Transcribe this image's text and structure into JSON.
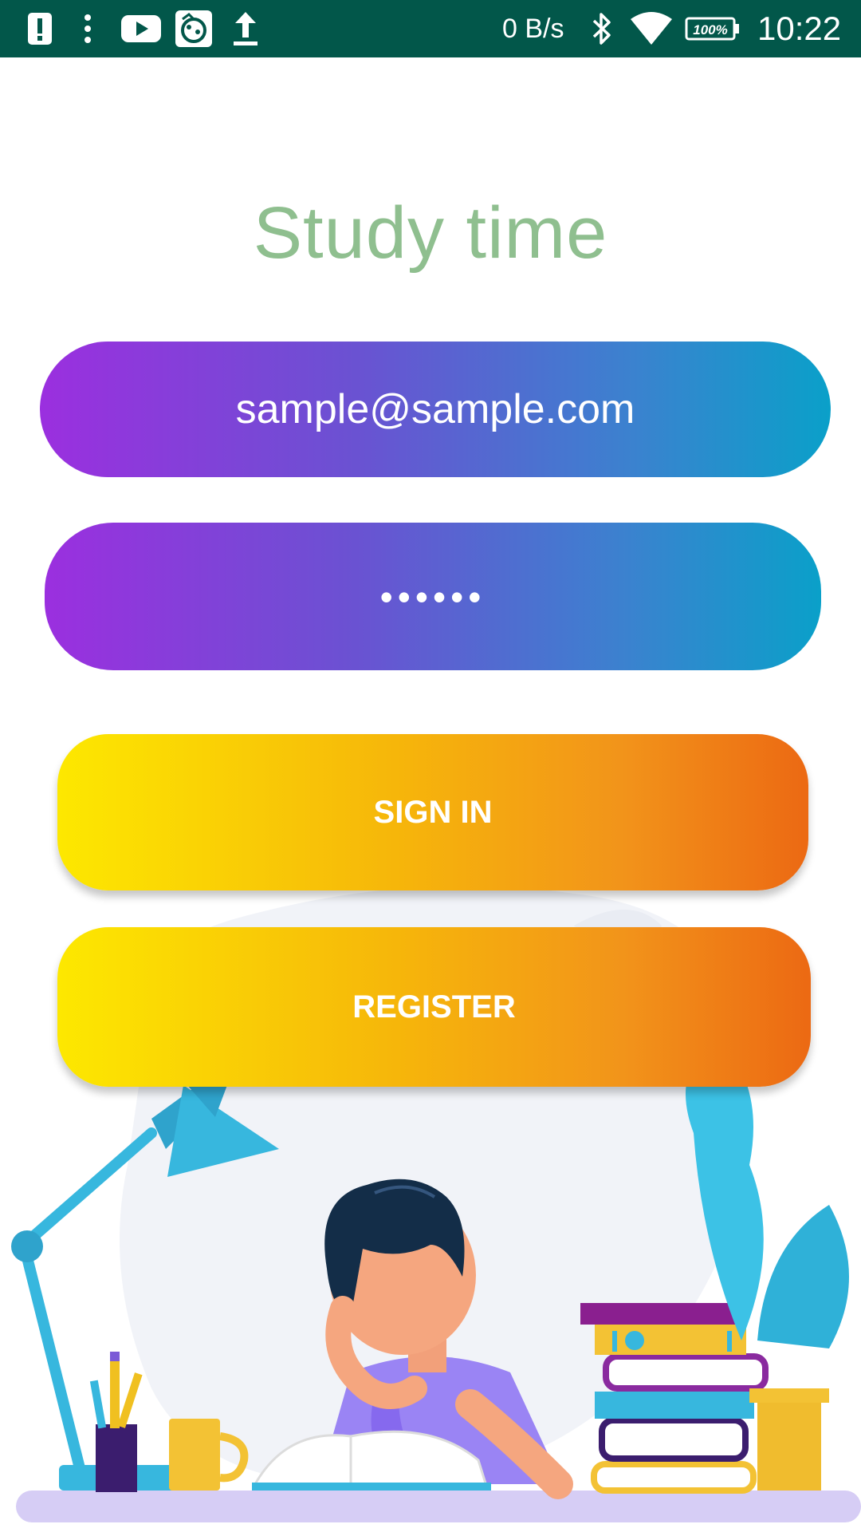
{
  "status_bar": {
    "net_speed": "0 B/s",
    "battery": "100%",
    "time": "10:22",
    "icons": [
      "alert-icon",
      "more-vert-icon",
      "youtube-icon",
      "app-icon",
      "upload-icon",
      "bluetooth-icon",
      "wifi-icon",
      "battery-icon"
    ]
  },
  "app": {
    "title": "Study time"
  },
  "form": {
    "email_value": "sample@sample.com",
    "password_value": "••••••",
    "signin_label": "SIGN IN",
    "register_label": "REGISTER"
  },
  "colors": {
    "status_bar": "#02574a",
    "title": "#8fbf8f",
    "field_gradient_start": "#9b2fdf",
    "field_gradient_end": "#0aa0c9",
    "button_gradient_start": "#fde800",
    "button_gradient_end": "#ec6913"
  }
}
